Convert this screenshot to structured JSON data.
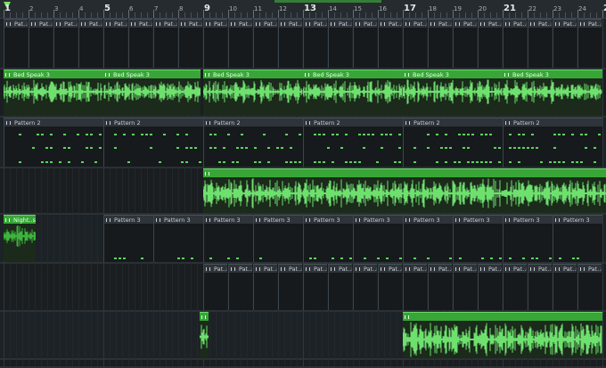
{
  "ruler": {
    "bar_labels": [
      "1",
      "2",
      "3",
      "4",
      "5",
      "6",
      "7",
      "8",
      "9",
      "10",
      "11",
      "12",
      "13",
      "14",
      "15",
      "16",
      "17",
      "18",
      "19",
      "20",
      "21",
      "22",
      "23",
      "24",
      "25"
    ],
    "major_bars": [
      "1",
      "5",
      "9",
      "13",
      "17",
      "21",
      "25"
    ]
  },
  "clips": {
    "pat_m1": "Pat..m 1",
    "pat_m4": "Pat..m 4",
    "bed_speak": "Bed Speak 3",
    "pattern2": "Pattern 2",
    "pattern3": "Pattern 3",
    "night_sion": "Night..sion"
  },
  "colors": {
    "audio_header": "#37a637",
    "audio_wave": "#6ee06e",
    "pattern_header": "#2e3439",
    "background": "#1b1f22"
  }
}
